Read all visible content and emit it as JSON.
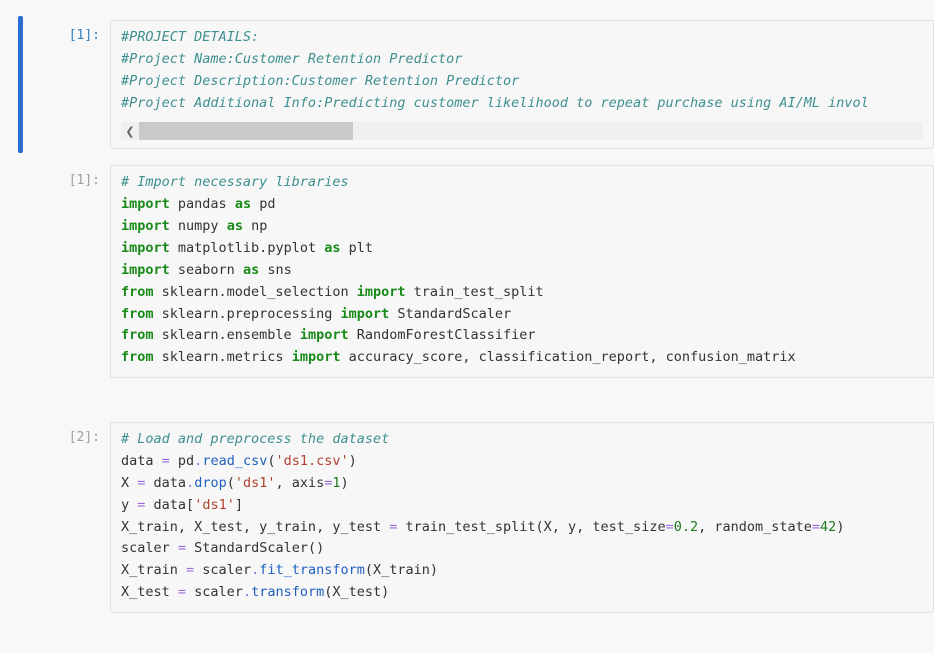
{
  "cells": [
    {
      "selected": true,
      "prompt": "[1]:",
      "scrollbar": true,
      "tokens": [
        [
          [
            "comment",
            "#PROJECT DETAILS:"
          ]
        ],
        [
          [
            "comment",
            "#Project Name:Customer Retention Predictor"
          ]
        ],
        [
          [
            "comment",
            "#Project Description:Customer Retention Predictor"
          ]
        ],
        [
          [
            "comment",
            "#Project Additional Info:Predicting customer likelihood to repeat purchase using AI/ML invol"
          ]
        ]
      ]
    },
    {
      "selected": false,
      "prompt": "[1]:",
      "scrollbar": false,
      "tokens": [
        [
          [
            "comment",
            "# Import necessary libraries"
          ]
        ],
        [
          [
            "kw",
            "import"
          ],
          [
            "plain",
            " pandas "
          ],
          [
            "kw",
            "as"
          ],
          [
            "plain",
            " pd"
          ]
        ],
        [
          [
            "kw",
            "import"
          ],
          [
            "plain",
            " numpy "
          ],
          [
            "kw",
            "as"
          ],
          [
            "plain",
            " np"
          ]
        ],
        [
          [
            "kw",
            "import"
          ],
          [
            "plain",
            " matplotlib.pyplot "
          ],
          [
            "kw",
            "as"
          ],
          [
            "plain",
            " plt"
          ]
        ],
        [
          [
            "kw",
            "import"
          ],
          [
            "plain",
            " seaborn "
          ],
          [
            "kw",
            "as"
          ],
          [
            "plain",
            " sns"
          ]
        ],
        [
          [
            "kw",
            "from"
          ],
          [
            "plain",
            " sklearn.model_selection "
          ],
          [
            "kw",
            "import"
          ],
          [
            "plain",
            " train_test_split"
          ]
        ],
        [
          [
            "kw",
            "from"
          ],
          [
            "plain",
            " sklearn.preprocessing "
          ],
          [
            "kw",
            "import"
          ],
          [
            "plain",
            " StandardScaler"
          ]
        ],
        [
          [
            "kw",
            "from"
          ],
          [
            "plain",
            " sklearn.ensemble "
          ],
          [
            "kw",
            "import"
          ],
          [
            "plain",
            " RandomForestClassifier"
          ]
        ],
        [
          [
            "kw",
            "from"
          ],
          [
            "plain",
            " sklearn.metrics "
          ],
          [
            "kw",
            "import"
          ],
          [
            "plain",
            " accuracy_score, classification_report, confusion_matrix"
          ]
        ]
      ]
    },
    {
      "selected": false,
      "prompt": "[2]:",
      "scrollbar": false,
      "tokens": [
        [
          [
            "comment",
            "# Load and preprocess the dataset"
          ]
        ],
        [
          [
            "plain",
            "data "
          ],
          [
            "op",
            "="
          ],
          [
            "plain",
            " pd"
          ],
          [
            "op",
            "."
          ],
          [
            "fn",
            "read_csv"
          ],
          [
            "plain",
            "("
          ],
          [
            "str",
            "'ds1.csv'"
          ],
          [
            "plain",
            ")"
          ]
        ],
        [
          [
            "plain",
            "X "
          ],
          [
            "op",
            "="
          ],
          [
            "plain",
            " data"
          ],
          [
            "op",
            "."
          ],
          [
            "fn",
            "drop"
          ],
          [
            "plain",
            "("
          ],
          [
            "str",
            "'ds1'"
          ],
          [
            "plain",
            ", axis"
          ],
          [
            "op",
            "="
          ],
          [
            "num",
            "1"
          ],
          [
            "plain",
            ")"
          ]
        ],
        [
          [
            "plain",
            "y "
          ],
          [
            "op",
            "="
          ],
          [
            "plain",
            " data["
          ],
          [
            "str",
            "'ds1'"
          ],
          [
            "plain",
            "]"
          ]
        ],
        [
          [
            "plain",
            "X_train, X_test, y_train, y_test "
          ],
          [
            "op",
            "="
          ],
          [
            "plain",
            " train_test_split(X, y, test_size"
          ],
          [
            "op",
            "="
          ],
          [
            "num",
            "0.2"
          ],
          [
            "plain",
            ", random_state"
          ],
          [
            "op",
            "="
          ],
          [
            "num",
            "42"
          ],
          [
            "plain",
            ")"
          ]
        ],
        [
          [
            "plain",
            "scaler "
          ],
          [
            "op",
            "="
          ],
          [
            "plain",
            " StandardScaler()"
          ]
        ],
        [
          [
            "plain",
            "X_train "
          ],
          [
            "op",
            "="
          ],
          [
            "plain",
            " scaler"
          ],
          [
            "op",
            "."
          ],
          [
            "fn",
            "fit_transform"
          ],
          [
            "plain",
            "(X_train)"
          ]
        ],
        [
          [
            "plain",
            "X_test "
          ],
          [
            "op",
            "="
          ],
          [
            "plain",
            " scaler"
          ],
          [
            "op",
            "."
          ],
          [
            "fn",
            "transform"
          ],
          [
            "plain",
            "(X_test)"
          ]
        ]
      ]
    }
  ],
  "scrollbar": {
    "left_glyph": "❮",
    "right_glyph": ""
  }
}
